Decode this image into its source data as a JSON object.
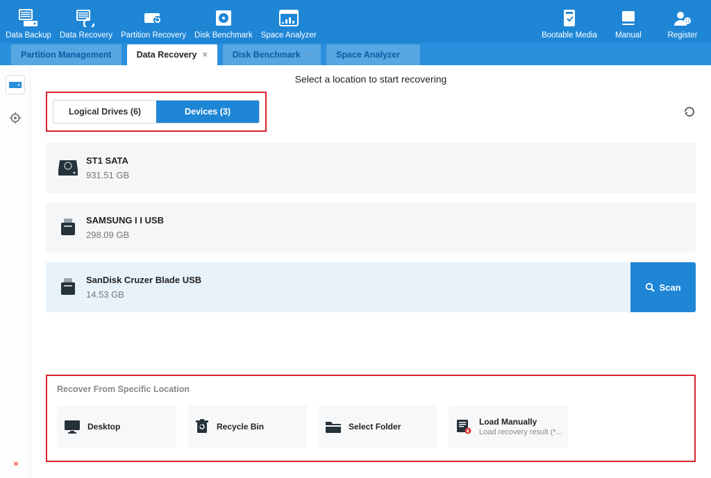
{
  "ribbon": {
    "left": [
      {
        "label": "Data Backup"
      },
      {
        "label": "Data Recovery"
      },
      {
        "label": "Partition Recovery"
      },
      {
        "label": "Disk Benchmark"
      },
      {
        "label": "Space Analyzer"
      }
    ],
    "right": [
      {
        "label": "Bootable Media"
      },
      {
        "label": "Manual"
      },
      {
        "label": "Register"
      }
    ]
  },
  "tabs": [
    {
      "label": "Partition Management",
      "closable": false
    },
    {
      "label": "Data Recovery",
      "closable": true,
      "active": true
    },
    {
      "label": "Disk Benchmark",
      "closable": true
    },
    {
      "label": "Space Analyzer",
      "closable": true
    }
  ],
  "headline": "Select a location to start recovering",
  "toggle": {
    "logical": "Logical Drives (6)",
    "devices": "Devices (3)"
  },
  "devices": [
    {
      "name": "ST1                         SATA",
      "size": "931.51 GB",
      "type": "hdd"
    },
    {
      "name": "SAMSUNG I            I USB",
      "size": "298.09 GB",
      "type": "usb"
    },
    {
      "name": "SanDisk Cruzer Blade USB",
      "size": "14.53 GB",
      "type": "usb",
      "selected": true
    }
  ],
  "scan_label": "Scan",
  "loc": {
    "title": "Recover From Specific Location",
    "items": [
      {
        "label": "Desktop"
      },
      {
        "label": "Recycle Bin"
      },
      {
        "label": "Select Folder"
      },
      {
        "label": "Load Manually",
        "sub": "Load recovery result (*..."
      }
    ]
  }
}
